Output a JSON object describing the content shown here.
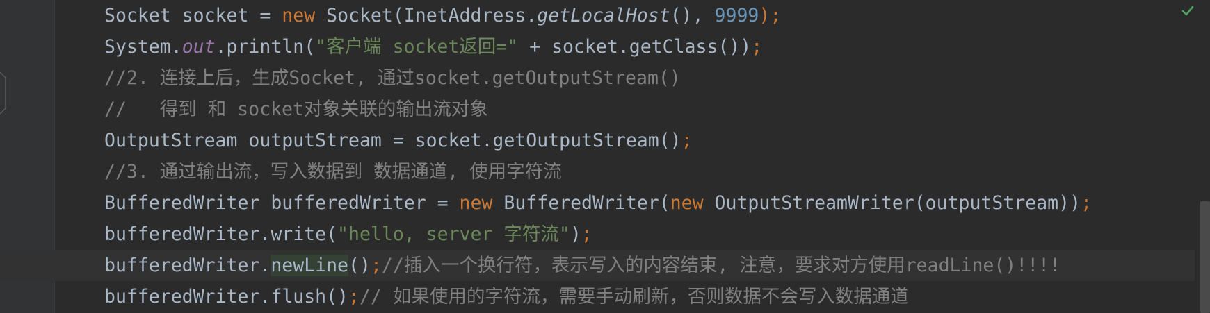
{
  "editor": {
    "lines": [
      [
        {
          "t": "Socket socket = ",
          "c": "plain"
        },
        {
          "t": "new",
          "c": "kw"
        },
        {
          "t": " Socket(InetAddress.",
          "c": "plain"
        },
        {
          "t": "getLocalHost",
          "c": "ital"
        },
        {
          "t": "(), ",
          "c": "plain"
        },
        {
          "t": "9999",
          "c": "num"
        },
        {
          "t": ");",
          "c": "semi"
        }
      ],
      [
        {
          "t": "System.",
          "c": "plain"
        },
        {
          "t": "out",
          "c": "field"
        },
        {
          "t": ".println(",
          "c": "plain"
        },
        {
          "t": "\"客户端 socket返回=\"",
          "c": "str"
        },
        {
          "t": " + socket.getClass())",
          "c": "plain"
        },
        {
          "t": ";",
          "c": "semi"
        }
      ],
      [
        {
          "t": "//2. 连接上后，生成Socket, 通过socket.getOutputStream()",
          "c": "com"
        }
      ],
      [
        {
          "t": "//   得到 和 socket对象关联的输出流对象",
          "c": "com"
        }
      ],
      [
        {
          "t": "OutputStream outputStream = socket.getOutputStream()",
          "c": "plain"
        },
        {
          "t": ";",
          "c": "semi"
        }
      ],
      [
        {
          "t": "//3. 通过输出流，写入数据到 数据通道, 使用字符流",
          "c": "com"
        }
      ],
      [
        {
          "t": "BufferedWriter bufferedWriter = ",
          "c": "plain"
        },
        {
          "t": "new",
          "c": "kw"
        },
        {
          "t": " BufferedWriter(",
          "c": "plain"
        },
        {
          "t": "new",
          "c": "kw"
        },
        {
          "t": " OutputStreamWriter(outputStream))",
          "c": "plain"
        },
        {
          "t": ";",
          "c": "semi"
        }
      ],
      [
        {
          "t": "bufferedWriter.write(",
          "c": "plain"
        },
        {
          "t": "\"hello, server 字符流\"",
          "c": "str"
        },
        {
          "t": ")",
          "c": "plain"
        },
        {
          "t": ";",
          "c": "semi"
        }
      ],
      [
        {
          "t": "bufferedWriter.",
          "c": "plain"
        },
        {
          "t": "newLine",
          "c": "hl"
        },
        {
          "t": "()",
          "c": "plain"
        },
        {
          "t": ";",
          "c": "semi"
        },
        {
          "t": "//插入一个换行符，表示写入的内容结束, 注意，要求对方使用readLine()!!!!",
          "c": "com"
        }
      ],
      [
        {
          "t": "bufferedWriter.flush()",
          "c": "plain"
        },
        {
          "t": ";",
          "c": "semi"
        },
        {
          "t": "// 如果使用的字符流，需要手动刷新，否则数据不会写入数据通道",
          "c": "com"
        }
      ]
    ],
    "current_line": 8,
    "colors": {
      "background": "#2b2b2b",
      "keyword": "#cc7832",
      "number": "#6897bb",
      "string": "#6a8759",
      "comment": "#808080",
      "text": "#a9b7c6",
      "field": "#9876aa",
      "inspection_ok": "#4ea35f"
    },
    "inspection_icon": "check-icon"
  }
}
